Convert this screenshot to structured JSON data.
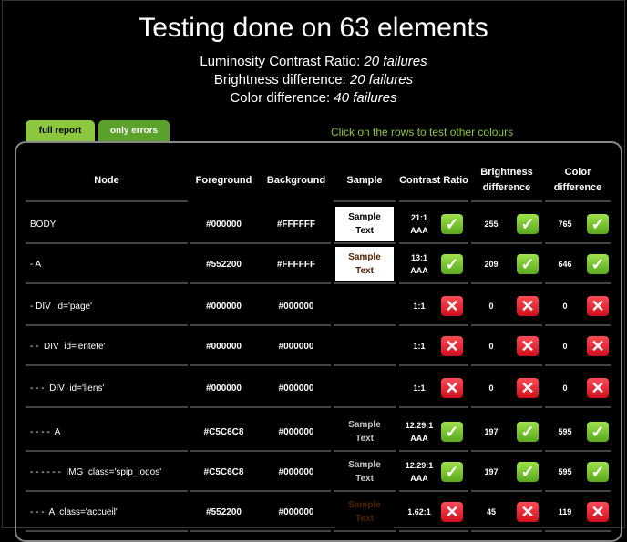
{
  "header": {
    "title": "Testing done on 63 elements",
    "luminosity_label": "Luminosity Contrast Ratio:",
    "luminosity_value": "20 failures",
    "brightness_label": "Brightness difference:",
    "brightness_value": "20 failures",
    "color_label": "Color difference:",
    "color_value": "40 failures"
  },
  "tabs": {
    "full_report": "full report",
    "only_errors": "only errors"
  },
  "hint": "Click on the rows to test other colours",
  "table": {
    "headers": {
      "node": "Node",
      "foreground": "Foreground",
      "background": "Background",
      "sample": "Sample",
      "contrast": "Contrast Ratio",
      "brightness": "Brightness difference",
      "color": "Color difference"
    },
    "rows": [
      {
        "node": "BODY",
        "fg": "#000000",
        "bg": "#FFFFFF",
        "sample_1": "Sample",
        "sample_2": "Text",
        "sample_bg": "#ffffff",
        "sample_fg": "#000000",
        "cr_value": "21:1",
        "cr_grade": "AAA",
        "cr_ok": true,
        "br_value": "255",
        "br_ok": true,
        "cd_value": "765",
        "cd_ok": true
      },
      {
        "node": "- A",
        "fg": "#552200",
        "bg": "#FFFFFF",
        "sample_1": "Sample",
        "sample_2": "Text",
        "sample_bg": "#ffffff",
        "sample_fg": "#552200",
        "cr_value": "13:1",
        "cr_grade": "AAA",
        "cr_ok": true,
        "br_value": "209",
        "br_ok": true,
        "cd_value": "646",
        "cd_ok": true
      },
      {
        "node": "- DIV  id='page'",
        "fg": "#000000",
        "bg": "#000000",
        "sample_1": "",
        "sample_2": "",
        "sample_bg": "#000000",
        "sample_fg": "#000000",
        "cr_value": "1:1",
        "cr_grade": "",
        "cr_ok": false,
        "br_value": "0",
        "br_ok": false,
        "cd_value": "0",
        "cd_ok": false
      },
      {
        "node": "- -  DIV  id='entete'",
        "fg": "#000000",
        "bg": "#000000",
        "sample_1": "",
        "sample_2": "",
        "sample_bg": "#000000",
        "sample_fg": "#000000",
        "cr_value": "1:1",
        "cr_grade": "",
        "cr_ok": false,
        "br_value": "0",
        "br_ok": false,
        "cd_value": "0",
        "cd_ok": false
      },
      {
        "node": "- - -  DIV  id='liens'",
        "fg": "#000000",
        "bg": "#000000",
        "sample_1": "",
        "sample_2": "",
        "sample_bg": "#000000",
        "sample_fg": "#000000",
        "cr_value": "1:1",
        "cr_grade": "",
        "cr_ok": false,
        "br_value": "0",
        "br_ok": false,
        "cd_value": "0",
        "cd_ok": false
      },
      {
        "node": "- - - -  A",
        "fg": "#C5C6C8",
        "bg": "#000000",
        "sample_1": "Sample",
        "sample_2": "Text",
        "sample_bg": "#000000",
        "sample_fg": "#C5C6C8",
        "cr_value": "12.29:1",
        "cr_grade": "AAA",
        "cr_ok": true,
        "br_value": "197",
        "br_ok": true,
        "cd_value": "595",
        "cd_ok": true
      },
      {
        "node": "- - - - - -  IMG  class='spip_logos'",
        "fg": "#C5C6C8",
        "bg": "#000000",
        "sample_1": "Sample",
        "sample_2": "Text",
        "sample_bg": "#000000",
        "sample_fg": "#C5C6C8",
        "cr_value": "12.29:1",
        "cr_grade": "AAA",
        "cr_ok": true,
        "br_value": "197",
        "br_ok": true,
        "cd_value": "595",
        "cd_ok": true
      },
      {
        "node": "- - -  A  class='accueil'",
        "fg": "#552200",
        "bg": "#000000",
        "sample_1": "Sample",
        "sample_2": "Text",
        "sample_bg": "#000000",
        "sample_fg": "#552200",
        "cr_value": "1.62:1",
        "cr_grade": "",
        "cr_ok": false,
        "br_value": "45",
        "br_ok": false,
        "cd_value": "119",
        "cd_ok": false
      }
    ]
  },
  "colors": {
    "pass": "#7ac943",
    "fail": "#e8192c",
    "tab_active": "#8dc63f",
    "tab_inactive": "#5ca12b",
    "hint": "#8dc63f"
  },
  "icons": {
    "pass": "check-icon",
    "fail": "cross-icon"
  }
}
